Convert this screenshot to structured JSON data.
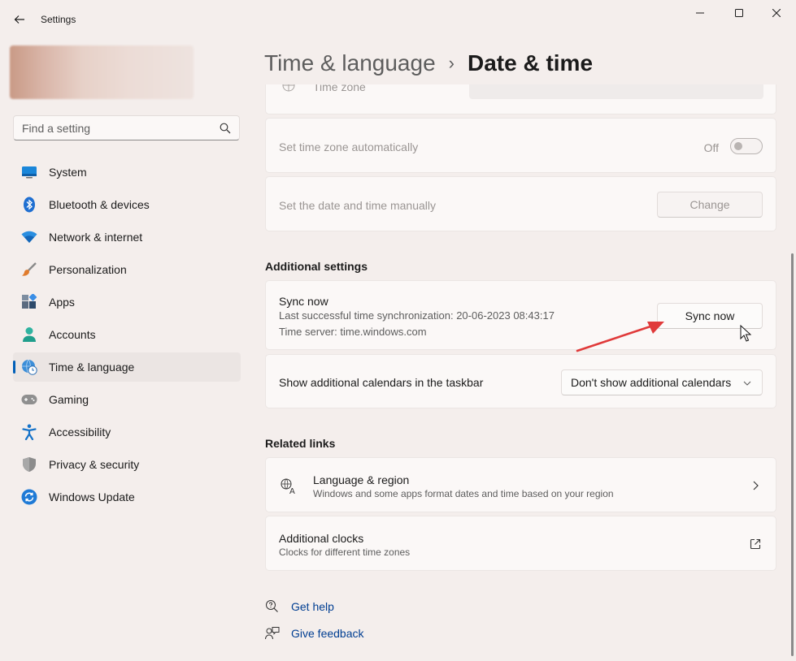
{
  "window": {
    "title": "Settings"
  },
  "search": {
    "placeholder": "Find a setting"
  },
  "sidebar": {
    "items": [
      {
        "label": "System",
        "icon": "monitor-icon"
      },
      {
        "label": "Bluetooth & devices",
        "icon": "bluetooth-icon"
      },
      {
        "label": "Network & internet",
        "icon": "wifi-icon"
      },
      {
        "label": "Personalization",
        "icon": "brush-icon"
      },
      {
        "label": "Apps",
        "icon": "apps-icon"
      },
      {
        "label": "Accounts",
        "icon": "person-icon"
      },
      {
        "label": "Time & language",
        "icon": "globe-clock-icon",
        "active": true
      },
      {
        "label": "Gaming",
        "icon": "gamepad-icon"
      },
      {
        "label": "Accessibility",
        "icon": "accessibility-icon"
      },
      {
        "label": "Privacy & security",
        "icon": "shield-icon"
      },
      {
        "label": "Windows Update",
        "icon": "update-icon"
      }
    ]
  },
  "header": {
    "parent": "Time & language",
    "separator": "›",
    "current": "Date & time"
  },
  "time_zone": {
    "label": "Time zone"
  },
  "auto_timezone": {
    "label": "Set time zone automatically",
    "state": "Off"
  },
  "manual_time": {
    "label": "Set the date and time manually",
    "button": "Change"
  },
  "additional_settings": {
    "title": "Additional settings",
    "sync": {
      "title": "Sync now",
      "last_sync": "Last successful time synchronization: 20-06-2023 08:43:17",
      "server": "Time server: time.windows.com",
      "button": "Sync now"
    },
    "calendars": {
      "label": "Show additional calendars in the taskbar",
      "selected": "Don't show additional calendars"
    }
  },
  "related_links": {
    "title": "Related links",
    "items": [
      {
        "title": "Language & region",
        "subtitle": "Windows and some apps format dates and time based on your region"
      },
      {
        "title": "Additional clocks",
        "subtitle": "Clocks for different time zones"
      }
    ]
  },
  "footer": {
    "help": "Get help",
    "feedback": "Give feedback"
  },
  "colors": {
    "accent": "#005fb8",
    "link": "#003e92",
    "annotation_arrow": "#e03a3a"
  }
}
